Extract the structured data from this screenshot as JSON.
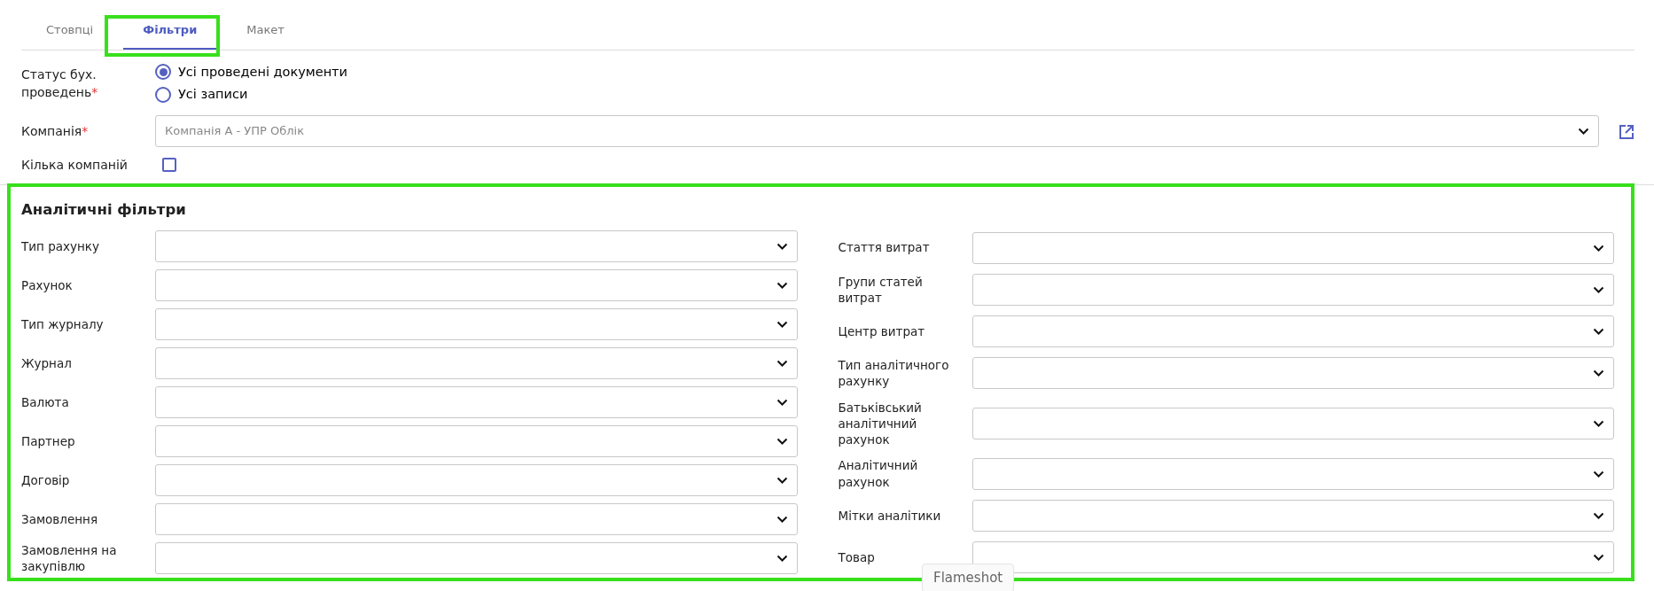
{
  "tabs": [
    {
      "label": "Стовпці",
      "selected": false
    },
    {
      "label": "Фільтри",
      "selected": true
    },
    {
      "label": "Макет",
      "selected": false
    }
  ],
  "status": {
    "label": "Статус бух. проведень",
    "required": true,
    "required_mark": "*",
    "options": [
      {
        "label": "Усі проведені документи",
        "selected": true
      },
      {
        "label": "Усі записи",
        "selected": false
      }
    ]
  },
  "company": {
    "label": "Компанія",
    "required": true,
    "required_mark": "*",
    "placeholder": "Компанія А - УПР Облік"
  },
  "multi_company": {
    "label": "Кілька компаній",
    "checked": false
  },
  "analytic_filters": {
    "title": "Аналітичні фільтри",
    "left": [
      {
        "label": "Тип рахунку"
      },
      {
        "label": "Рахунок"
      },
      {
        "label": "Тип журналу"
      },
      {
        "label": "Журнал"
      },
      {
        "label": "Валюта"
      },
      {
        "label": "Партнер"
      },
      {
        "label": "Договір"
      },
      {
        "label": "Замовлення"
      },
      {
        "label": "Замовлення на закупівлю"
      }
    ],
    "right": [
      {
        "label": "Стаття витрат"
      },
      {
        "label": "Групи статей витрат"
      },
      {
        "label": "Центр витрат"
      },
      {
        "label": "Тип аналітичного рахунку"
      },
      {
        "label": "Батьківський аналітичний рахунок"
      },
      {
        "label": "Аналітичний рахунок"
      },
      {
        "label": "Мітки аналітики"
      },
      {
        "label": "Товар"
      }
    ]
  },
  "tooltip": "Flameshot"
}
